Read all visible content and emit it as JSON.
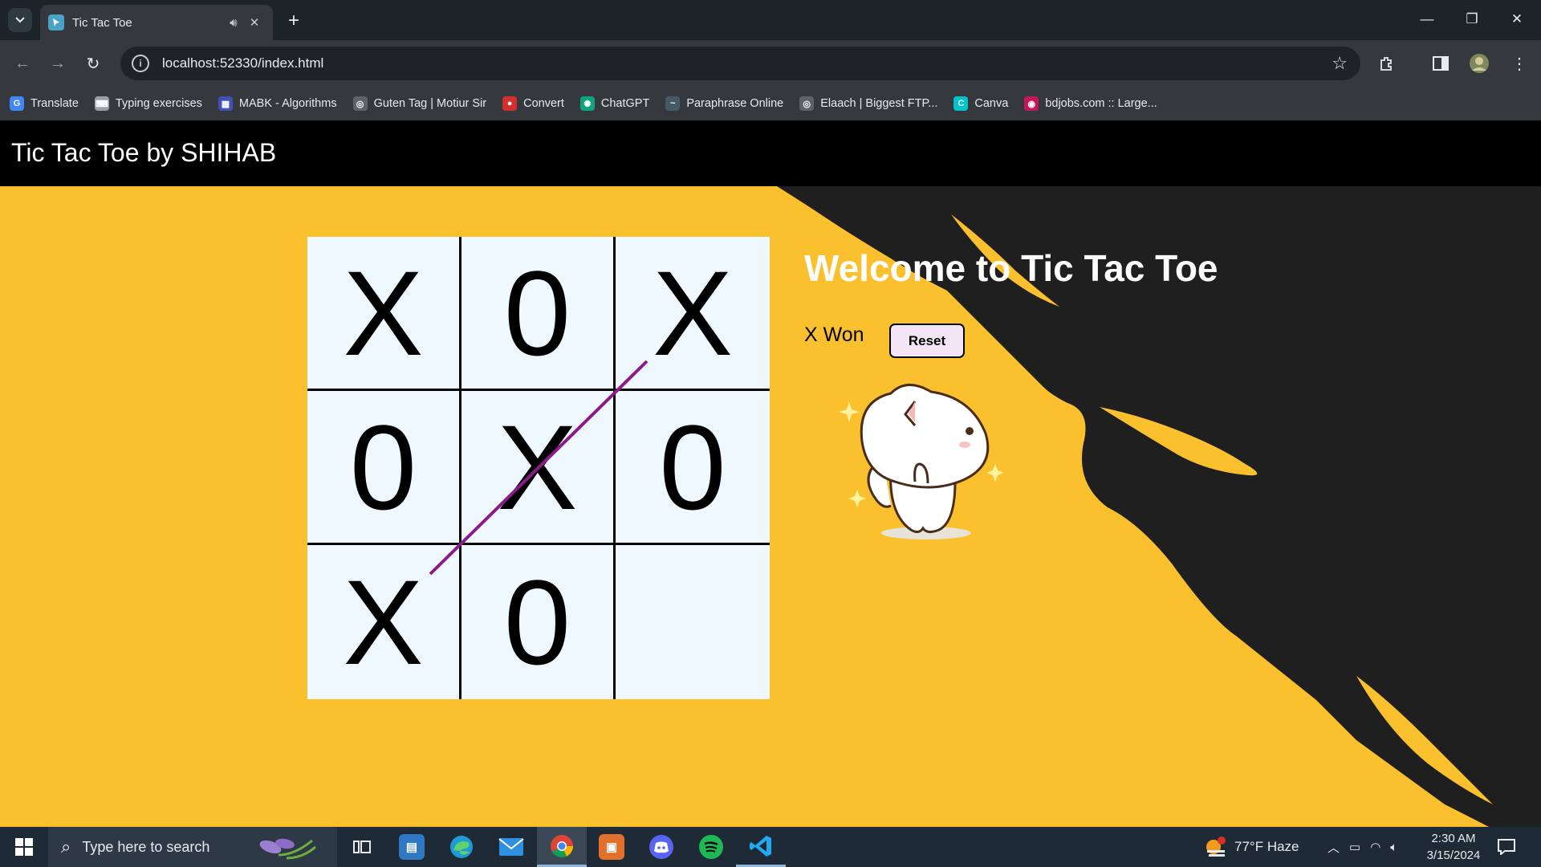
{
  "browser": {
    "tab_title": "Tic Tac Toe",
    "url": "localhost:52330/index.html",
    "bookmarks": [
      {
        "label": "Translate",
        "color": "#4285f4",
        "glyph": "G"
      },
      {
        "label": "Typing exercises",
        "color": "#9aa0a6",
        "glyph": "⌨"
      },
      {
        "label": "MABK - Algorithms",
        "color": "#3f51b5",
        "glyph": "▦"
      },
      {
        "label": "Guten Tag | Motiur Sir",
        "color": "#5f6368",
        "glyph": "◎"
      },
      {
        "label": "Convert",
        "color": "#d32f2f",
        "glyph": "●"
      },
      {
        "label": "ChatGPT",
        "color": "#10a37f",
        "glyph": "✺"
      },
      {
        "label": "Paraphrase Online",
        "color": "#455a64",
        "glyph": "~"
      },
      {
        "label": "Elaach | Biggest FTP...",
        "color": "#5f6368",
        "glyph": "◎"
      },
      {
        "label": "Canva",
        "color": "#00c4cc",
        "glyph": "C"
      },
      {
        "label": "bdjobs.com :: Large...",
        "color": "#c2185b",
        "glyph": "◉"
      }
    ]
  },
  "page": {
    "site_title": "Tic Tac Toe by SHIHAB",
    "welcome": "Welcome to Tic Tac Toe",
    "status": "X Won",
    "reset_label": "Reset",
    "board": [
      "X",
      "0",
      "X",
      "0",
      "X",
      "0",
      "X",
      "0",
      ""
    ],
    "colors": {
      "background": "#fbc02d",
      "accent_dark": "#1f1f1f",
      "win_line": "#8b1a8b",
      "board": "#f0f8ff"
    }
  },
  "taskbar": {
    "search_placeholder": "Type here to search",
    "weather": "77°F  Haze",
    "time": "2:30 AM",
    "date": "3/15/2024"
  }
}
